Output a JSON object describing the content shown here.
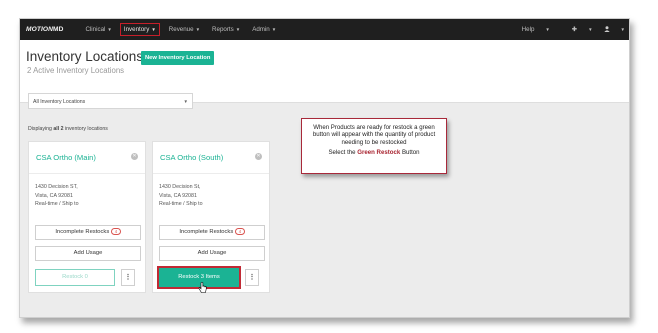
{
  "nav": {
    "brand": "MOTION",
    "brand_suffix": "MD",
    "items": [
      {
        "label": "Clinical"
      },
      {
        "label": "Inventory"
      },
      {
        "label": "Revenue"
      },
      {
        "label": "Reports"
      },
      {
        "label": "Admin"
      }
    ],
    "right": {
      "help": "Help"
    }
  },
  "header": {
    "title": "Inventory Locations",
    "new_button": "New Inventory Location",
    "subtitle": "2 Active Inventory Locations"
  },
  "filter": {
    "value": "All Inventory Locations"
  },
  "displaying": {
    "prefix": "Displaying ",
    "all": "all 2",
    "suffix": " inventory locations"
  },
  "cards": [
    {
      "title": "CSA Ortho (Main)",
      "address1": "1430 Decision ST,",
      "address2": "Vista, CA 92081",
      "mode": "Real-time / Ship to",
      "incomplete_label": "Incomplete Restocks",
      "incomplete_count": "4",
      "add_usage": "Add Usage",
      "restock": "Restock 0"
    },
    {
      "title": "CSA Ortho (South)",
      "address1": "1430 Decision St,",
      "address2": "Vista, CA 92081",
      "mode": "Real-time / Ship to",
      "incomplete_label": "Incomplete Restocks",
      "incomplete_count": "4",
      "add_usage": "Add Usage",
      "restock": "Restock 3 Items"
    }
  ],
  "callout": {
    "line1": "When Products are ready for restock a green button will appear with the quantity of product needing to be restocked",
    "line2_prefix": "Select the ",
    "line2_bold": "Green Restock",
    "line2_suffix": " Button"
  },
  "colors": {
    "accent": "#1bb394",
    "highlight": "#c61f2a",
    "nav_bg": "#1f1f1f"
  }
}
